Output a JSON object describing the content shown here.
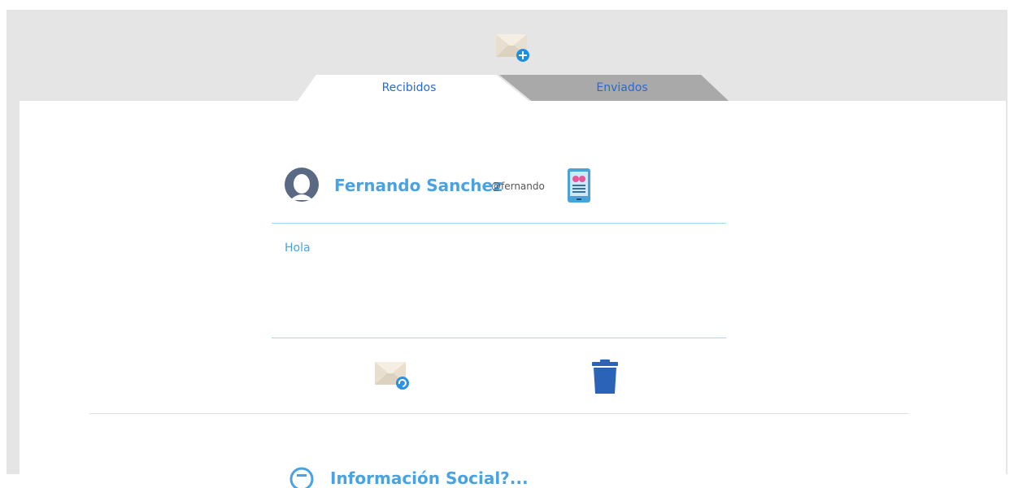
{
  "tabs": {
    "inbox_label": "Recibidos",
    "sent_label": "Enviados"
  },
  "message": {
    "sender_name": "Fernando Sanchez",
    "sender_handle": "@fernando",
    "body": "Hola"
  },
  "next_item": {
    "title": "Información Social?..."
  },
  "icons": {
    "compose": "envelope-plus-icon",
    "avatar": "user-avatar-icon",
    "device": "mobile-device-icon",
    "reply": "envelope-reply-icon",
    "delete": "trash-icon"
  },
  "colors": {
    "accent": "#4aa3e0",
    "tab_text": "#2a6ad0",
    "trash": "#2a63b8",
    "inactive_tab": "#a9a9a9"
  }
}
